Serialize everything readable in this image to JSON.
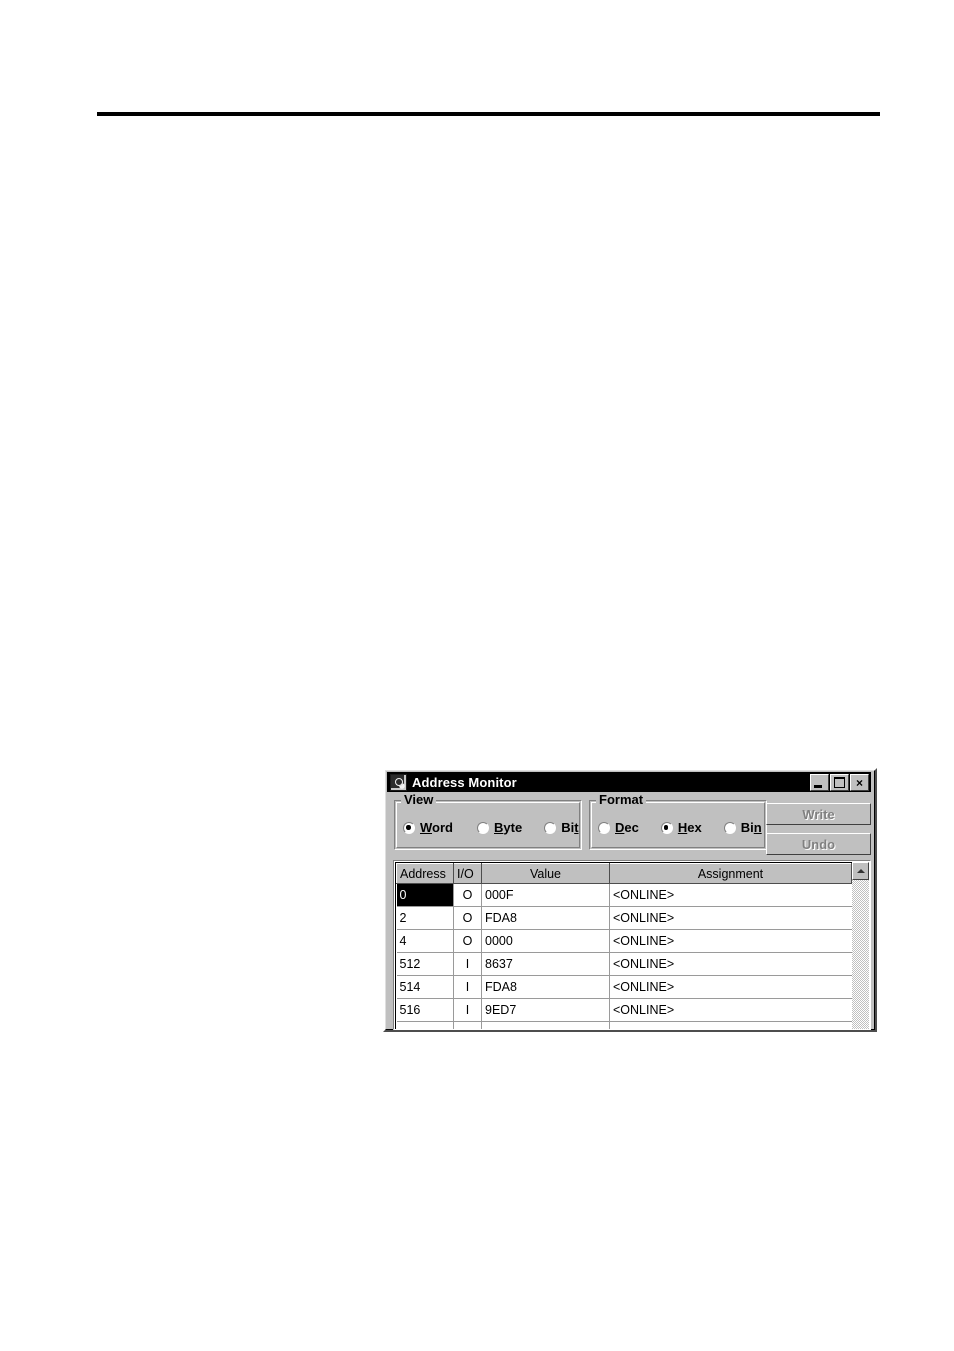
{
  "page": {
    "background_color": "#ffffff",
    "rule_color": "#000000"
  },
  "dialog": {
    "title": "Address Monitor",
    "title_icon": "magnifier-document-icon",
    "titlebar_color": "#000000",
    "face_color": "#c0c0c0",
    "window_buttons": [
      {
        "name": "minimize-button",
        "glyph": "minimize-icon"
      },
      {
        "name": "maximize-button",
        "glyph": "maximize-icon"
      },
      {
        "name": "close-button",
        "glyph": "×"
      }
    ],
    "view_group": {
      "legend": "View",
      "options": [
        {
          "label_pre": "",
          "label_key": "W",
          "label_post": "ord",
          "selected": true
        },
        {
          "label_pre": "",
          "label_key": "B",
          "label_post": "yte",
          "selected": false
        },
        {
          "label_pre": "Bi",
          "label_key": "t",
          "label_post": "",
          "selected": false
        }
      ],
      "selected_value": "Word"
    },
    "format_group": {
      "legend": "Format",
      "options": [
        {
          "label_pre": "",
          "label_key": "D",
          "label_post": "ec",
          "selected": false
        },
        {
          "label_pre": "",
          "label_key": "H",
          "label_post": "ex",
          "selected": true
        },
        {
          "label_pre": "Bi",
          "label_key": "n",
          "label_post": "",
          "selected": false
        }
      ],
      "selected_value": "Hex"
    },
    "buttons": [
      {
        "label": "Write",
        "enabled": false
      },
      {
        "label": "Undo",
        "enabled": false
      }
    ],
    "grid": {
      "columns": [
        "Address",
        "I/O",
        "Value",
        "Assignment"
      ],
      "rows": [
        {
          "address": "0",
          "io": "O",
          "value": "000F",
          "assignment": "<ONLINE>",
          "selected": true
        },
        {
          "address": "2",
          "io": "O",
          "value": "FDA8",
          "assignment": "<ONLINE>",
          "selected": false
        },
        {
          "address": "4",
          "io": "O",
          "value": "0000",
          "assignment": "<ONLINE>",
          "selected": false
        },
        {
          "address": "512",
          "io": "I",
          "value": "8637",
          "assignment": "<ONLINE>",
          "selected": false
        },
        {
          "address": "514",
          "io": "I",
          "value": "FDA8",
          "assignment": "<ONLINE>",
          "selected": false
        },
        {
          "address": "516",
          "io": "I",
          "value": "9ED7",
          "assignment": "<ONLINE>",
          "selected": false
        }
      ],
      "scrollbar": {
        "up_arrow_icon": "triangle-up-icon",
        "track_style": "dotted"
      }
    }
  }
}
